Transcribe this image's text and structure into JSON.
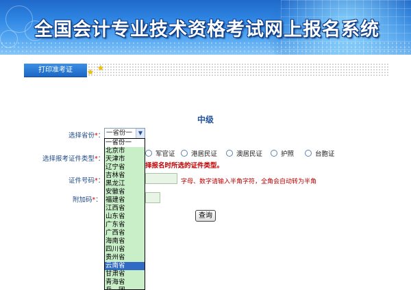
{
  "header": {
    "title": "全国会计专业技术资格考试网上报名系统"
  },
  "nav": {
    "tab_label": "打印准考证"
  },
  "form": {
    "level": "中级",
    "province_label": "选择省份",
    "province_selected": "一省份一",
    "cert_type_label": "选择报考证件类型",
    "cert_types": [
      "军官证",
      "港居民证",
      "澳居民证",
      "护照",
      "台胞证"
    ],
    "cert_hint": "择报名时所选的证件类型。",
    "cert_no_label": "证件号码",
    "cert_no_note": "字母、数字请输入半角字符，全角会自动转为半角",
    "extra_code_label": "附加码",
    "required_mark": "*",
    "colon": "：",
    "query_button": "查询"
  },
  "province_dropdown": {
    "options": [
      "一省份一",
      "北京市",
      "天津市",
      "辽宁省",
      "吉林省",
      "黑龙江",
      "安徽省",
      "福建省",
      "江西省",
      "山东省",
      "广东省",
      "广西省",
      "海南省",
      "四川省",
      "贵州省",
      "云南省",
      "甘肃省",
      "青海省",
      "兵　团"
    ],
    "highlighted": "云南省"
  },
  "colors": {
    "banner": "#2f86e3",
    "tab": "#1c67c4",
    "label": "#1f4a8a",
    "warning": "#c00000",
    "list_bg": "#c9efc9",
    "list_highlight": "#316ac5"
  }
}
